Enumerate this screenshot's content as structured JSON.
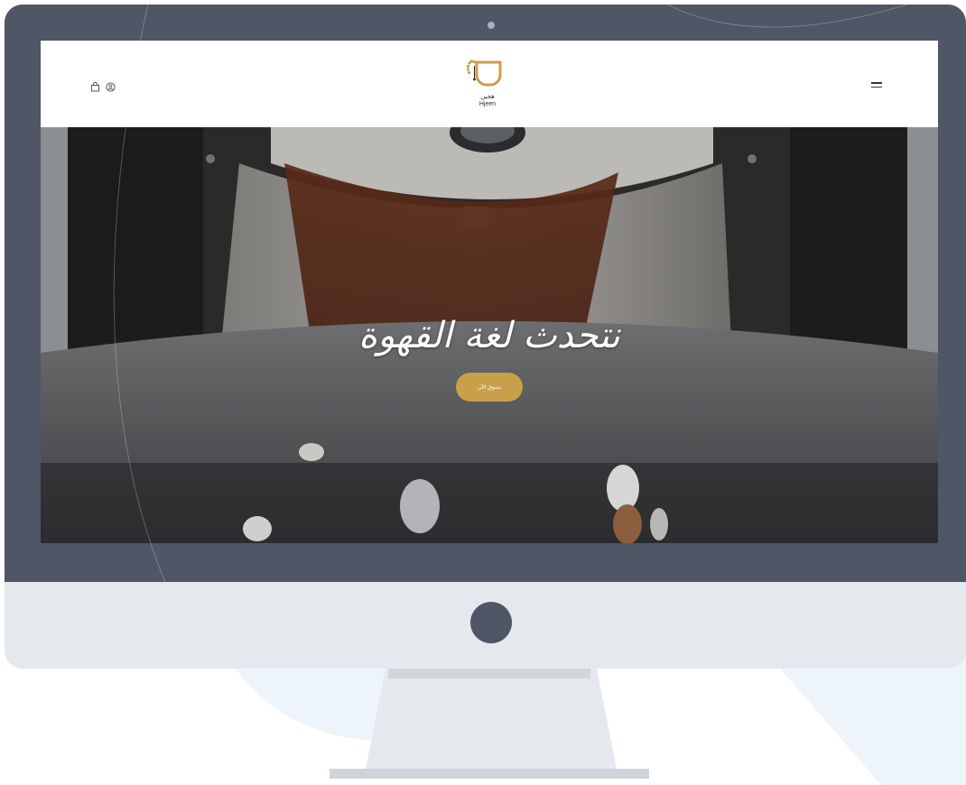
{
  "brand": {
    "name_ar": "هجين",
    "name_en": "Hjeen",
    "accent_color": "#c9a04a"
  },
  "header": {
    "left_icons": [
      "shopping-bag-icon",
      "user-circle-icon"
    ],
    "right_icon": "hamburger-menu-icon"
  },
  "hero": {
    "title": "نتحدث لغة القهوة",
    "button_label": "تسوق الآن",
    "background": "coffee-roaster-photo"
  },
  "device": {
    "frame_color": "#4f5665",
    "chin_color": "#e5e9ee"
  }
}
